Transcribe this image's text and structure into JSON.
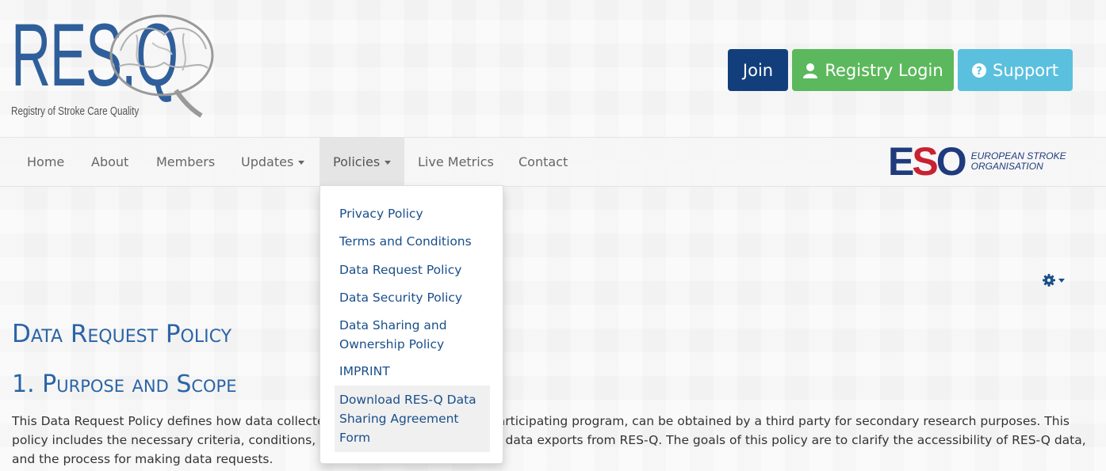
{
  "header": {
    "logo": {
      "text": "RES.Q",
      "subtitle": "Registry of Stroke Care Quality"
    },
    "buttons": {
      "join": "Join",
      "login": "Registry Login",
      "support": "Support"
    }
  },
  "nav": {
    "items": [
      {
        "label": "Home"
      },
      {
        "label": "About"
      },
      {
        "label": "Members"
      },
      {
        "label": "Updates"
      },
      {
        "label": "Policies"
      },
      {
        "label": "Live Metrics"
      },
      {
        "label": "Contact"
      }
    ],
    "eso": {
      "letters": "ESO",
      "line1": "EUROPEAN STROKE",
      "line2": "ORGANISATION"
    }
  },
  "dropdown": {
    "items": [
      "Privacy Policy",
      "Terms and Conditions",
      "Data Request Policy",
      "Data Security Policy",
      "Data Sharing and Ownership Policy",
      "IMPRINT",
      "Download RES-Q Data Sharing Agreement Form"
    ]
  },
  "content": {
    "title": "Data Request Policy",
    "section_title": "1. Purpose and Scope",
    "paragraph": "This Data Request Policy defines how data collected or as part of RES-Q, or a participating program, can be obtained by a third party for secondary research purposes. This policy includes the necessary criteria, conditions, and limitations for requesting data exports from RES-Q. The goals of this policy are to clarify the accessibility of RES-Q data, and the process for making data requests."
  },
  "colors": {
    "brand_blue": "#2a64a6",
    "join": "#123f7c",
    "login": "#5cb85c",
    "support": "#5bc0de",
    "eso_red": "#c9212f"
  },
  "icons": [
    "brain-logo",
    "user-icon",
    "question-circle-icon",
    "gear-icon",
    "caret-down-icon"
  ]
}
